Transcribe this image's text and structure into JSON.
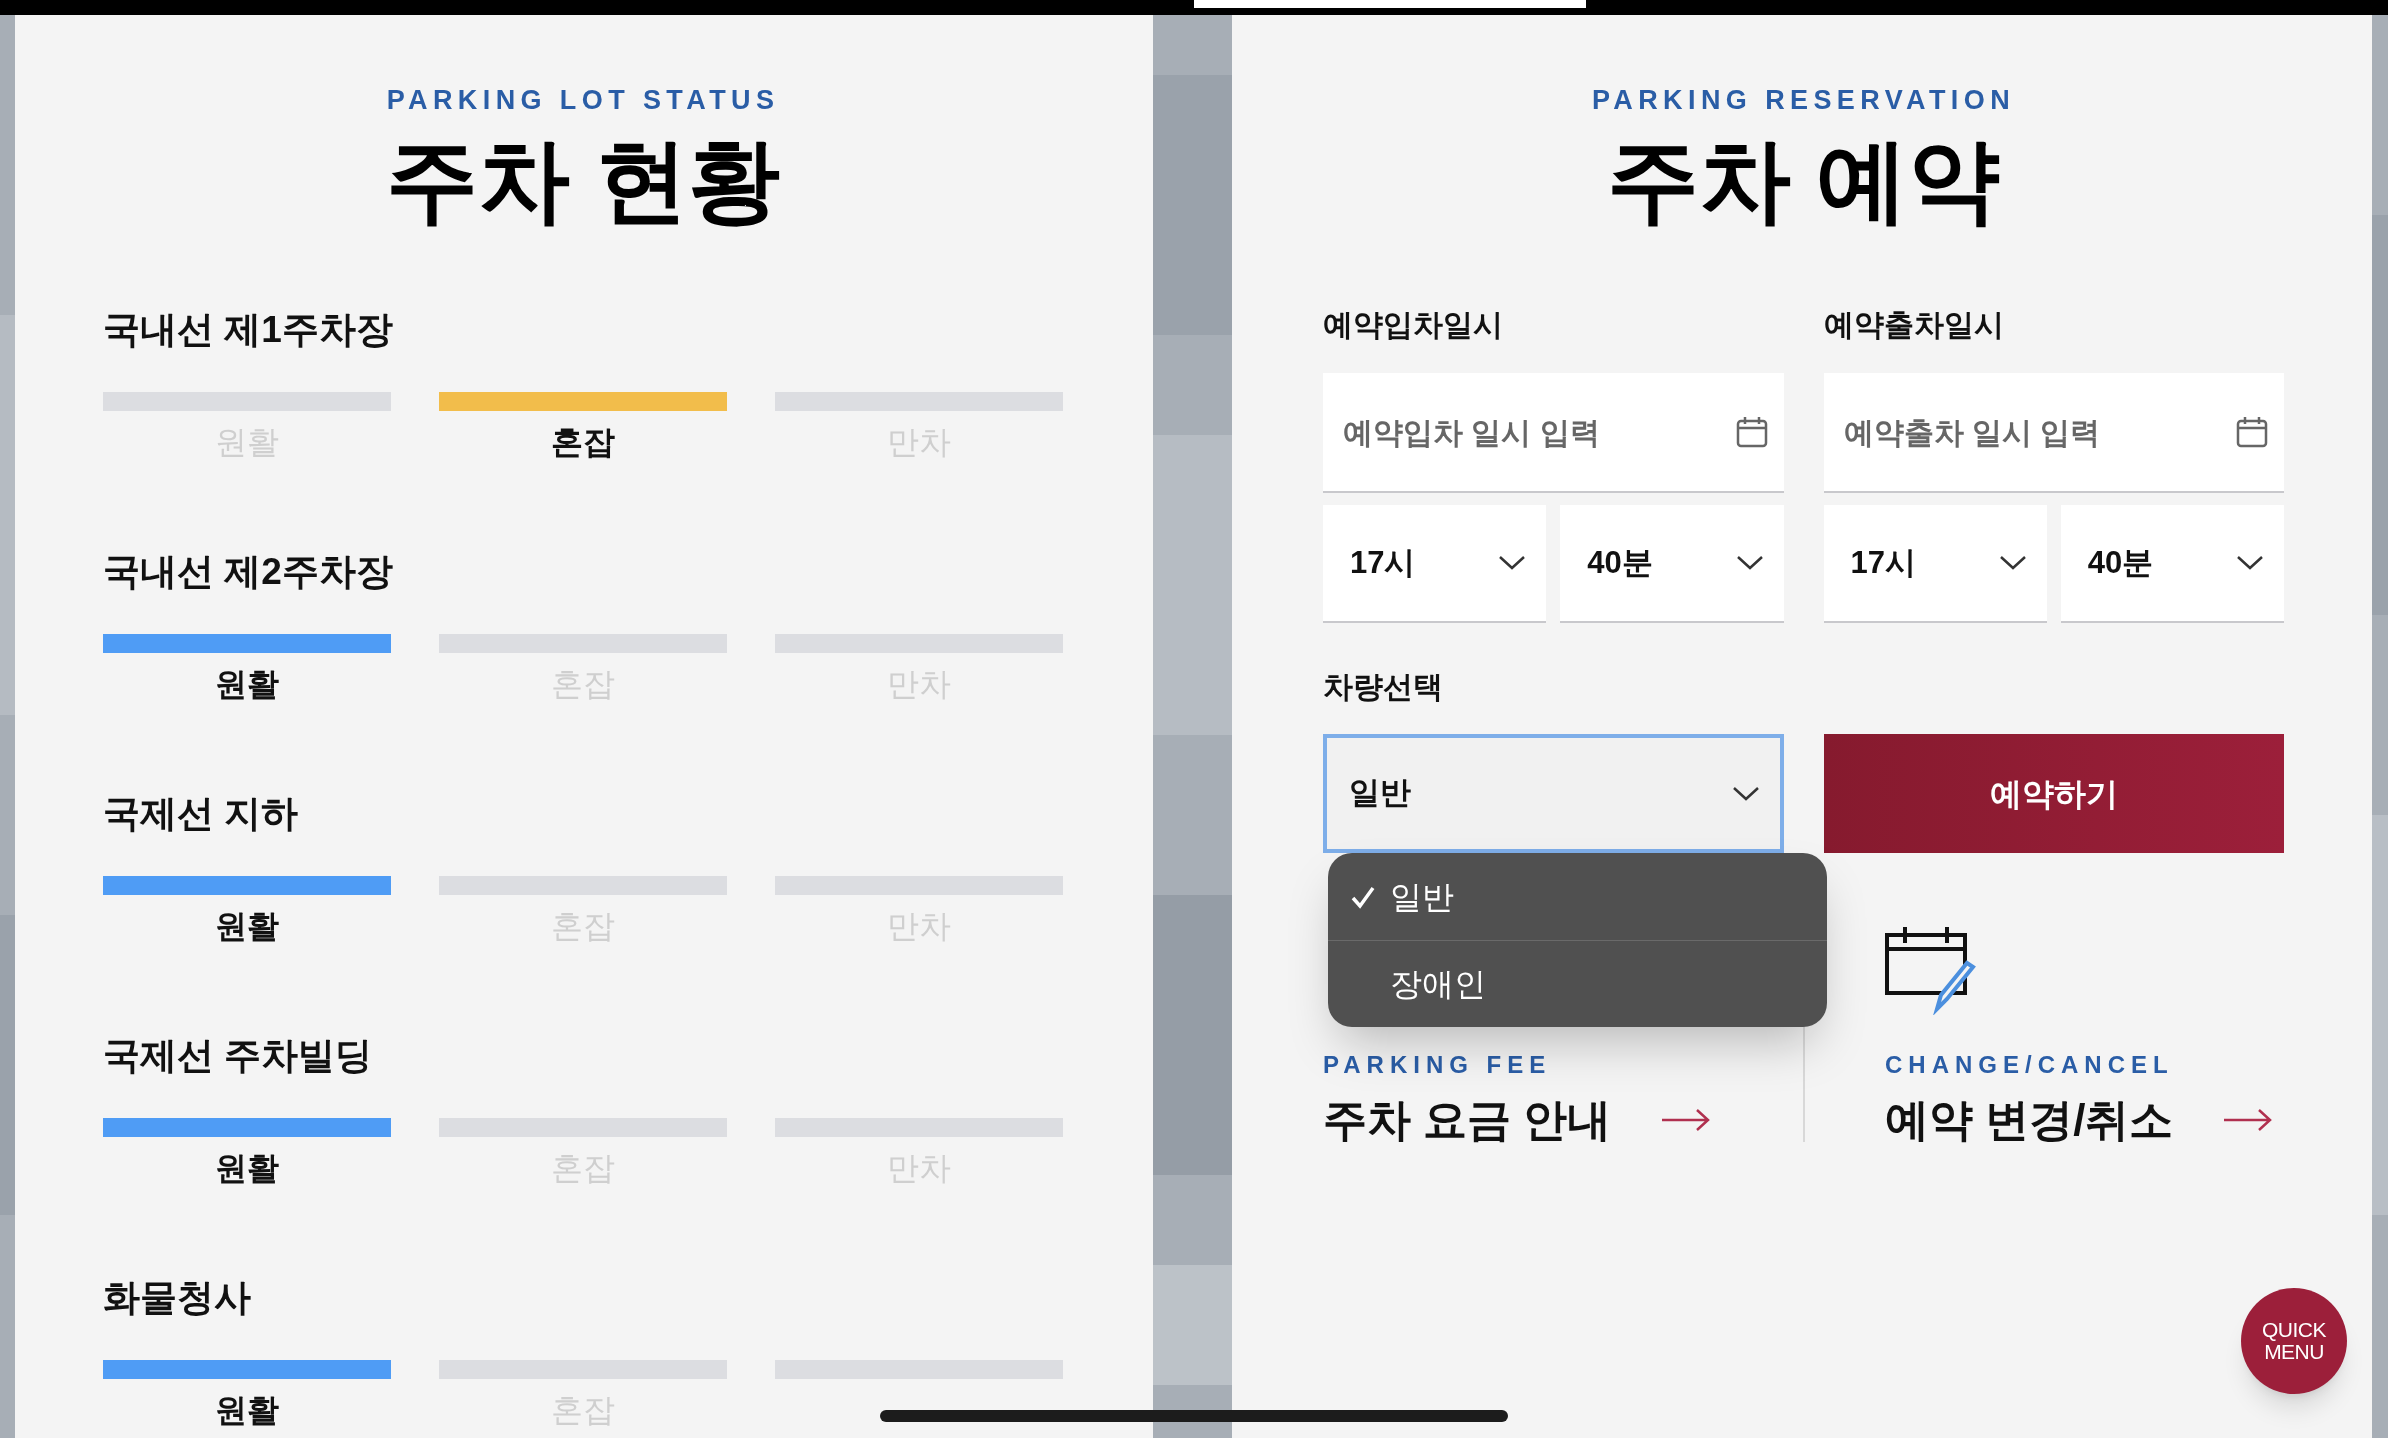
{
  "status_panel": {
    "eyebrow": "PARKING LOT STATUS",
    "title": "주차 현황",
    "lots": [
      {
        "name": "국내선 제1주차장",
        "segments": [
          {
            "label": "원활",
            "selected": false
          },
          {
            "label": "혼잡",
            "selected": true,
            "color": "#f2bd4b"
          },
          {
            "label": "만차",
            "selected": false
          }
        ]
      },
      {
        "name": "국내선 제2주차장",
        "segments": [
          {
            "label": "원활",
            "selected": true,
            "color": "#4f9cf5"
          },
          {
            "label": "혼잡",
            "selected": false
          },
          {
            "label": "만차",
            "selected": false
          }
        ]
      },
      {
        "name": "국제선 지하",
        "segments": [
          {
            "label": "원활",
            "selected": true,
            "color": "#4f9cf5"
          },
          {
            "label": "혼잡",
            "selected": false
          },
          {
            "label": "만차",
            "selected": false
          }
        ]
      },
      {
        "name": "국제선 주차빌딩",
        "segments": [
          {
            "label": "원활",
            "selected": true,
            "color": "#4f9cf5"
          },
          {
            "label": "혼잡",
            "selected": false
          },
          {
            "label": "만차",
            "selected": false
          }
        ]
      },
      {
        "name": "화물청사",
        "segments": [
          {
            "label": "원활",
            "selected": true,
            "color": "#4f9cf5"
          },
          {
            "label": "혼잡",
            "selected": false
          },
          {
            "selected": false
          }
        ]
      }
    ]
  },
  "reservation_panel": {
    "eyebrow": "PARKING RESERVATION",
    "title": "주차 예약",
    "entry": {
      "label": "예약입차일시",
      "placeholder": "예약입차 일시 입력",
      "hour": "17시",
      "minute": "40분"
    },
    "exit": {
      "label": "예약출차일시",
      "placeholder": "예약출차 일시 입력",
      "hour": "17시",
      "minute": "40분"
    },
    "vehicle": {
      "label": "차량선택",
      "value": "일반",
      "expanded": true,
      "options": [
        {
          "label": "일반",
          "selected": true
        },
        {
          "label": "장애인",
          "selected": false
        }
      ]
    },
    "submit": "예약하기",
    "links": [
      {
        "kind": "fee",
        "eyebrow": "PARKING FEE",
        "title": "주차 요금 안내"
      },
      {
        "kind": "change",
        "eyebrow": "CHANGE/CANCEL",
        "title": "예약 변경/취소"
      }
    ],
    "quick_menu": "QUICK MENU"
  }
}
